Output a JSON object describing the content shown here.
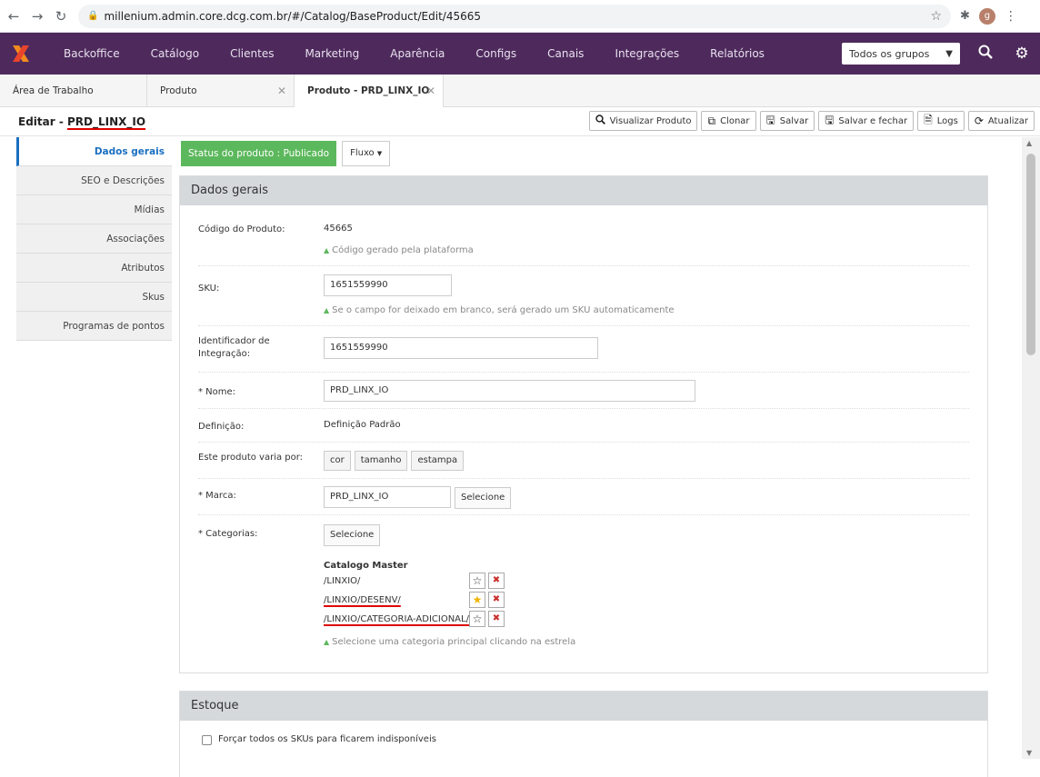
{
  "browser": {
    "url": "millenium.admin.core.dcg.com.br/#/Catalog/BaseProduct/Edit/45665",
    "profile_initial": "g"
  },
  "topnav": {
    "items": [
      "Backoffice",
      "Catálogo",
      "Clientes",
      "Marketing",
      "Aparência",
      "Configs",
      "Canais",
      "Integrações",
      "Relatórios"
    ],
    "group_select": "Todos os grupos",
    "brand_color": "#4e2a5c"
  },
  "tabs": [
    {
      "label": "Área de Trabalho"
    },
    {
      "label": "Produto"
    },
    {
      "label": "Produto - PRD_LINX_IO"
    }
  ],
  "edit": {
    "title_prefix": "Editar - ",
    "title_name": "PRD_LINX_IO",
    "actions": [
      "Visualizar Produto",
      "Clonar",
      "Salvar",
      "Salvar e fechar",
      "Logs",
      "Atualizar"
    ]
  },
  "sidemenu": [
    "Dados gerais",
    "SEO e Descrições",
    "Mídias",
    "Associações",
    "Atributos",
    "Skus",
    "Programas de pontos"
  ],
  "status": {
    "badge": "Status do produto : Publicado",
    "fluxo": "Fluxo"
  },
  "general": {
    "heading": "Dados gerais",
    "code_label": "Código do Produto:",
    "code_value": "45665",
    "code_hint": "Código gerado pela plataforma",
    "sku_label": "SKU:",
    "sku_value": "1651559990",
    "sku_hint": "Se o campo for deixado em branco, será gerado um SKU automaticamente",
    "integration_label_1": "Identificador de",
    "integration_label_2": "Integração:",
    "integration_value": "1651559990",
    "name_label": "* Nome:",
    "name_value": "PRD_LINX_IO",
    "definition_label": "Definição:",
    "definition_value": "Definição Padrão",
    "varies_label": "Este produto varia por:",
    "varies": [
      "cor",
      "tamanho",
      "estampa"
    ],
    "brand_label": "* Marca:",
    "brand_value": "PRD_LINX_IO",
    "select_label": "Selecione",
    "categories_label": "* Categorias:",
    "catalog_title": "Catalogo Master",
    "categories": [
      "/LINXIO/",
      "/LINXIO/DESENV/",
      "/LINXIO/CATEGORIA-ADICIONAL/"
    ],
    "categories_hint": "Selecione uma categoria principal clicando na estrela"
  },
  "stock": {
    "heading": "Estoque",
    "force_unavailable": "Forçar todos os SKUs para ficarem indisponíveis"
  }
}
